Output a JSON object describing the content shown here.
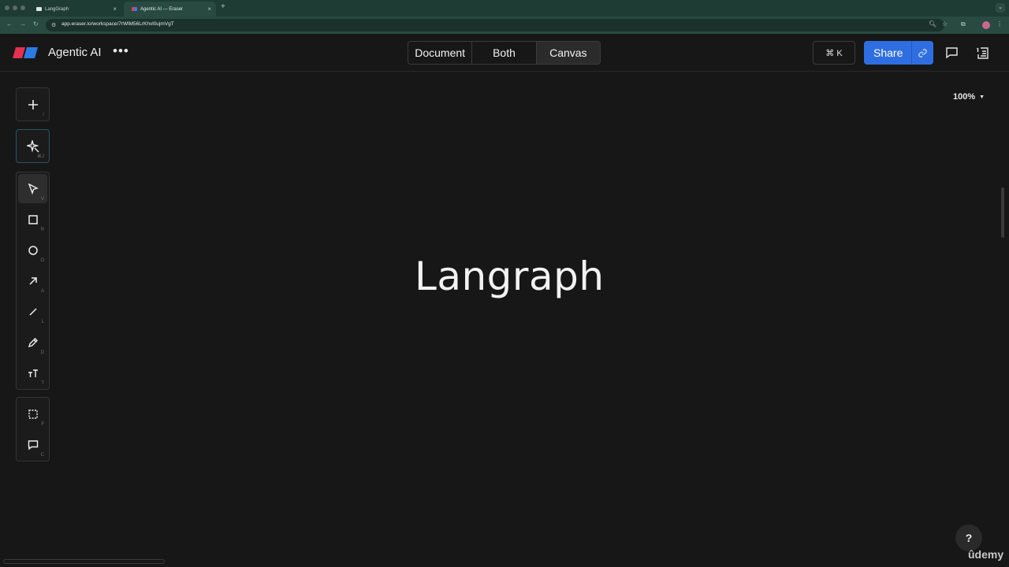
{
  "browser": {
    "tabs": [
      {
        "label": "LangGraph",
        "close": "×"
      },
      {
        "label": "Agentic AI — Eraser",
        "close": "×"
      }
    ],
    "new_tab": "+",
    "url": "app.eraser.io/workspace/7rWlM56LrKhvl0ujmVgT"
  },
  "header": {
    "title": "Agentic AI",
    "more": "•••",
    "view_modes": [
      "Document",
      "Both",
      "Canvas"
    ],
    "selected_view": "Canvas",
    "cmdk_label": "⌘ K",
    "share_label": "Share"
  },
  "toolbar": {
    "add_key": "/",
    "ai_key": "⌘J",
    "tools": [
      {
        "name": "select",
        "key": "V"
      },
      {
        "name": "rectangle",
        "key": "R"
      },
      {
        "name": "ellipse",
        "key": "O"
      },
      {
        "name": "arrow",
        "key": "A"
      },
      {
        "name": "line",
        "key": "L"
      },
      {
        "name": "pen",
        "key": "D"
      },
      {
        "name": "text",
        "key": "T"
      },
      {
        "name": "frame",
        "key": "F"
      },
      {
        "name": "comment",
        "key": "C"
      }
    ]
  },
  "canvas": {
    "zoom": "100%",
    "text": "Langraph"
  },
  "help_label": "?",
  "watermark": "ûdemy",
  "colors": {
    "accent": "#2f6ee0",
    "background": "#171717"
  }
}
